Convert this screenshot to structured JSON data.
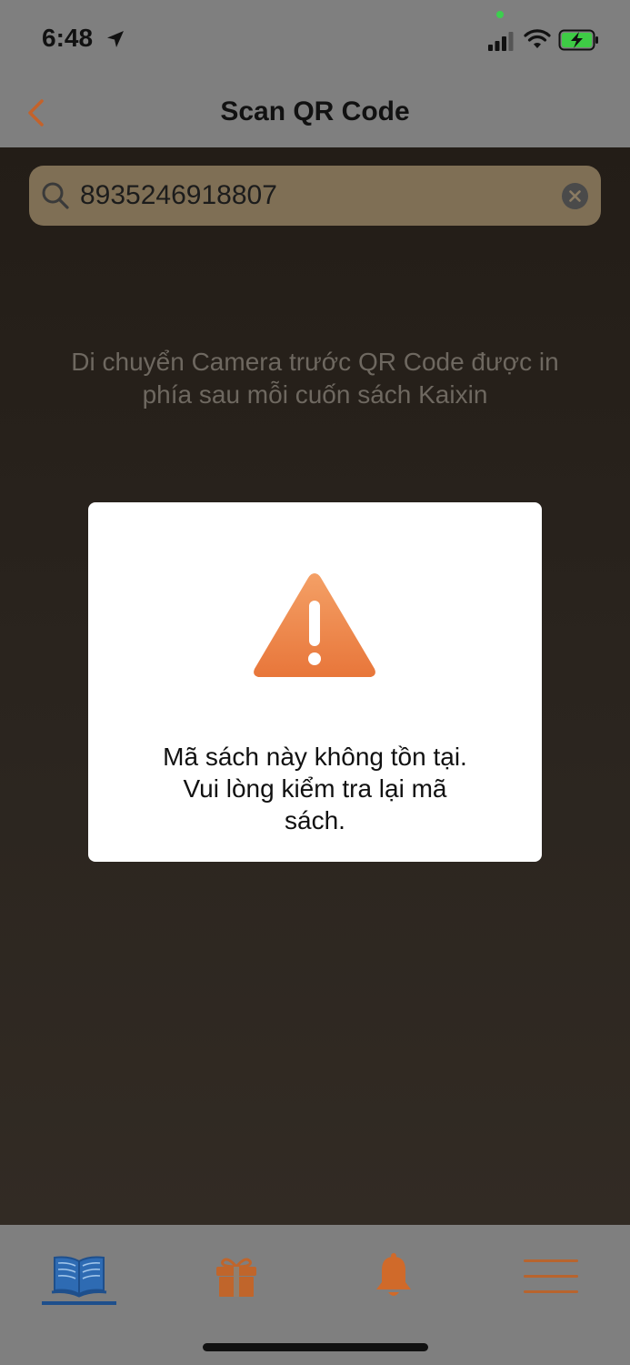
{
  "status_bar": {
    "time": "6:48"
  },
  "nav": {
    "title": "Scan QR Code",
    "back_icon": "chevron-left-icon"
  },
  "search": {
    "value": "8935246918807"
  },
  "camera": {
    "instruction_line1": "Di chuyển Camera trước QR Code được in",
    "instruction_line2": "phía sau mỗi cuốn sách Kaixin"
  },
  "dialog": {
    "icon": "warning-icon",
    "message_line1": "Mã sách này không tồn tại.",
    "message_line2": "Vui lòng kiểm tra lại mã",
    "message_line3": "sách."
  },
  "tab_bar": {
    "tabs": [
      {
        "icon": "book-icon",
        "selected": true
      },
      {
        "icon": "gift-icon",
        "selected": false
      },
      {
        "icon": "bell-icon",
        "selected": false
      },
      {
        "icon": "menu-icon",
        "selected": false
      }
    ]
  },
  "colors": {
    "accent": "#e07a30",
    "selected_tab": "#1e4f8c",
    "bar_background": "#7f7f7f"
  }
}
